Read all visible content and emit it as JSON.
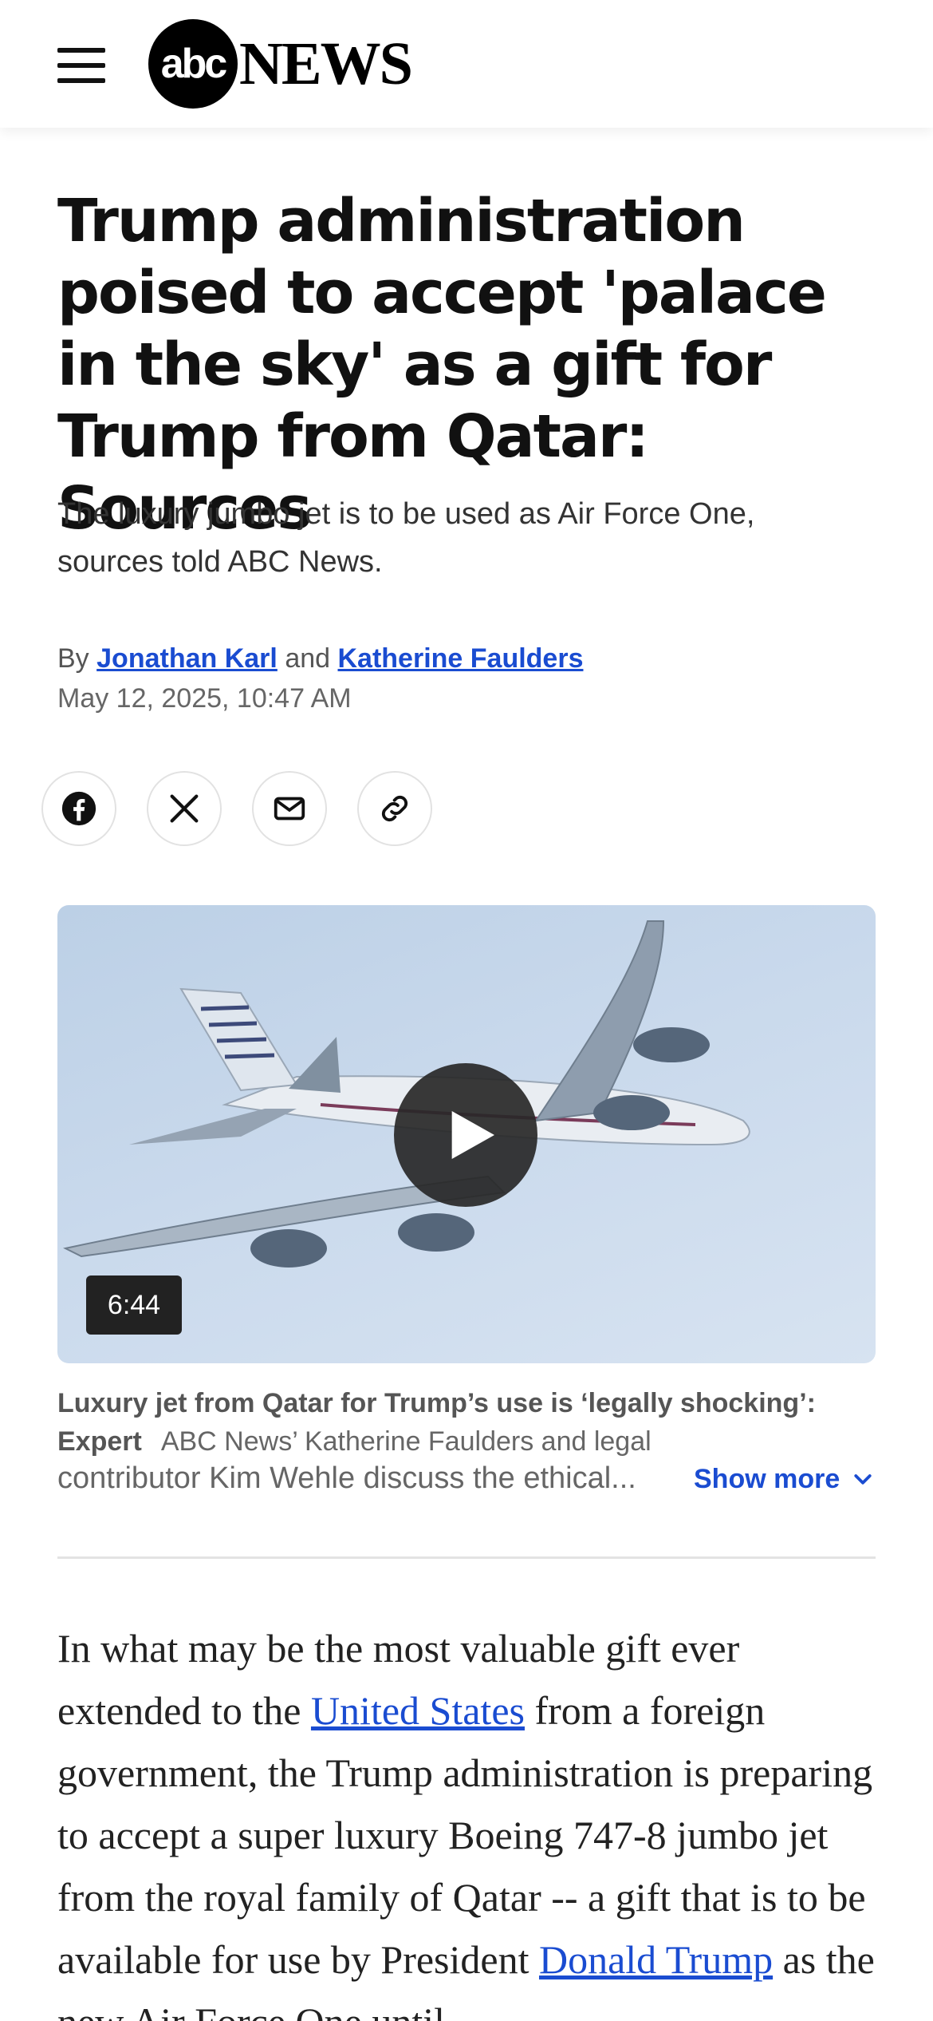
{
  "header": {
    "logo_abc": "abc",
    "logo_news": "NEWS",
    "menu_icon": "hamburger-menu-icon"
  },
  "article": {
    "headline": "Trump administration poised to accept 'palace in the sky' as a gift for Trump from Qatar: Sources",
    "subhead": "The luxury jumbo jet is to be used as Air Force One, sources told ABC News.",
    "byline_prefix": "By",
    "author1": "Jonathan Karl",
    "byline_and": "and",
    "author2": "Katherine Faulders",
    "date": "May 12, 2025, 10:47 AM"
  },
  "share": {
    "icons": [
      "facebook-icon",
      "x-icon",
      "email-icon",
      "link-icon"
    ]
  },
  "video": {
    "duration": "6:44",
    "caption_title": "Luxury jet from Qatar for Trump’s use is ‘legally shocking’: Expert",
    "caption_desc_part1": "ABC News’ Katherine Faulders and legal",
    "caption_desc_part2": "contributor Kim Wehle discuss the ethical...",
    "show_more": "Show more"
  },
  "body": {
    "p1_a": "In what may be the most valuable gift ever extended to the ",
    "p1_link1": "United States",
    "p1_b": " from a foreign government, the Trump administration is preparing to accept a super luxury Boeing 747-8 jumbo jet from the royal family of Qatar -- a gift that is to be available for use by President ",
    "p1_link2": "Donald Trump",
    "p1_c": " as the new Air Force One until"
  },
  "colors": {
    "link": "#1a4cd1",
    "video_bg": "#c9d9ec"
  }
}
